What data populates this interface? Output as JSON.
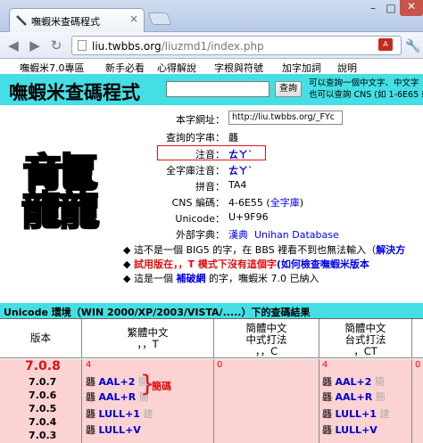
{
  "browser": {
    "tab_title": "嘸蝦米查碼程式",
    "url_host": "liu.twbbs.org",
    "url_path": "/liuzmd1/index.php"
  },
  "menu": {
    "items": [
      "嘸蝦米7.0專區",
      "新手必看",
      "心得解說",
      "字根與符號",
      "加字加詞",
      "說明"
    ]
  },
  "header": {
    "title": "嘸蝦米查碼程式",
    "search_value": "",
    "search_button": "查詢",
    "note_line1": "可以查詢一個中文字、中文字",
    "note_line2": "也可以查詢 CNS (如 1-6E65 或"
  },
  "char": {
    "big": "龘",
    "rows": [
      {
        "label": "本字網址：",
        "value": "http://liu.twbbs.org/_FYc"
      },
      {
        "label": "查詢的字串：",
        "value": "龘"
      },
      {
        "label": "注音：",
        "value": "ㄊㄚˋ"
      },
      {
        "label": "全字庫注音：",
        "value": "ㄊㄚˋ"
      },
      {
        "label": "拼音：",
        "value": "TA4"
      },
      {
        "label": "CNS 編碼：",
        "value": "4-6E55 (",
        "link": "全字庫",
        "tail": ")"
      },
      {
        "label": "Unicode：",
        "value": "U+9F96"
      },
      {
        "label": "外部字典：",
        "link1": "漢典",
        "link2": "Unihan Database"
      }
    ]
  },
  "notes": {
    "n1_text": "這不是一個 BIG5 的字，在 BBS 裡看不到也無法輸入（",
    "n1_link": "解決方",
    "n2_red": "試用版在，，T 模式下沒有這個字",
    "n2_link": "(如何檢查嘸蝦米版本",
    "n3_pre": "這是一個",
    "n3_link": "補破網",
    "n3_post": "的字，嘸蝦米 7.0 已納入"
  },
  "result": {
    "title": "Unicode 環境（WIN 2000/XP/2003/VISTA/.....）下的查碼結果",
    "col1": "版本",
    "col2_l1": "繁體中文",
    "col2_l2": "，，T",
    "col3_l1": "簡體中文",
    "col3_l2": "中式打法",
    "col3_l3": "，，C",
    "col4_l1": "簡體中文",
    "col4_l2": "台式打法",
    "col4_l3": "，CT",
    "versions": [
      "7.0.8",
      "7.0.7",
      "7.0.6",
      "7.0.5",
      "7.0.4",
      "7.0.3"
    ],
    "count_t": "4",
    "count_c": "0",
    "count_ct": "4",
    "codes_t": [
      {
        "char": "龘",
        "code": "AAL+2",
        "note": "簡"
      },
      {
        "char": "龘",
        "code": "AAL+R",
        "note": "簡"
      },
      {
        "char": "龘",
        "code": "LULL+1",
        "note": "建"
      },
      {
        "char": "龘",
        "code": "LULL+V",
        "note": ""
      }
    ],
    "codes_ct": [
      {
        "char": "龘",
        "code": "AAL+2",
        "note": "簡"
      },
      {
        "char": "龘",
        "code": "AAL+R",
        "note": "簡"
      },
      {
        "char": "龘",
        "code": "LULL+1",
        "note": "建"
      },
      {
        "char": "龘",
        "code": "LULL+V",
        "note": ""
      }
    ],
    "brace_label": "簡碼"
  }
}
